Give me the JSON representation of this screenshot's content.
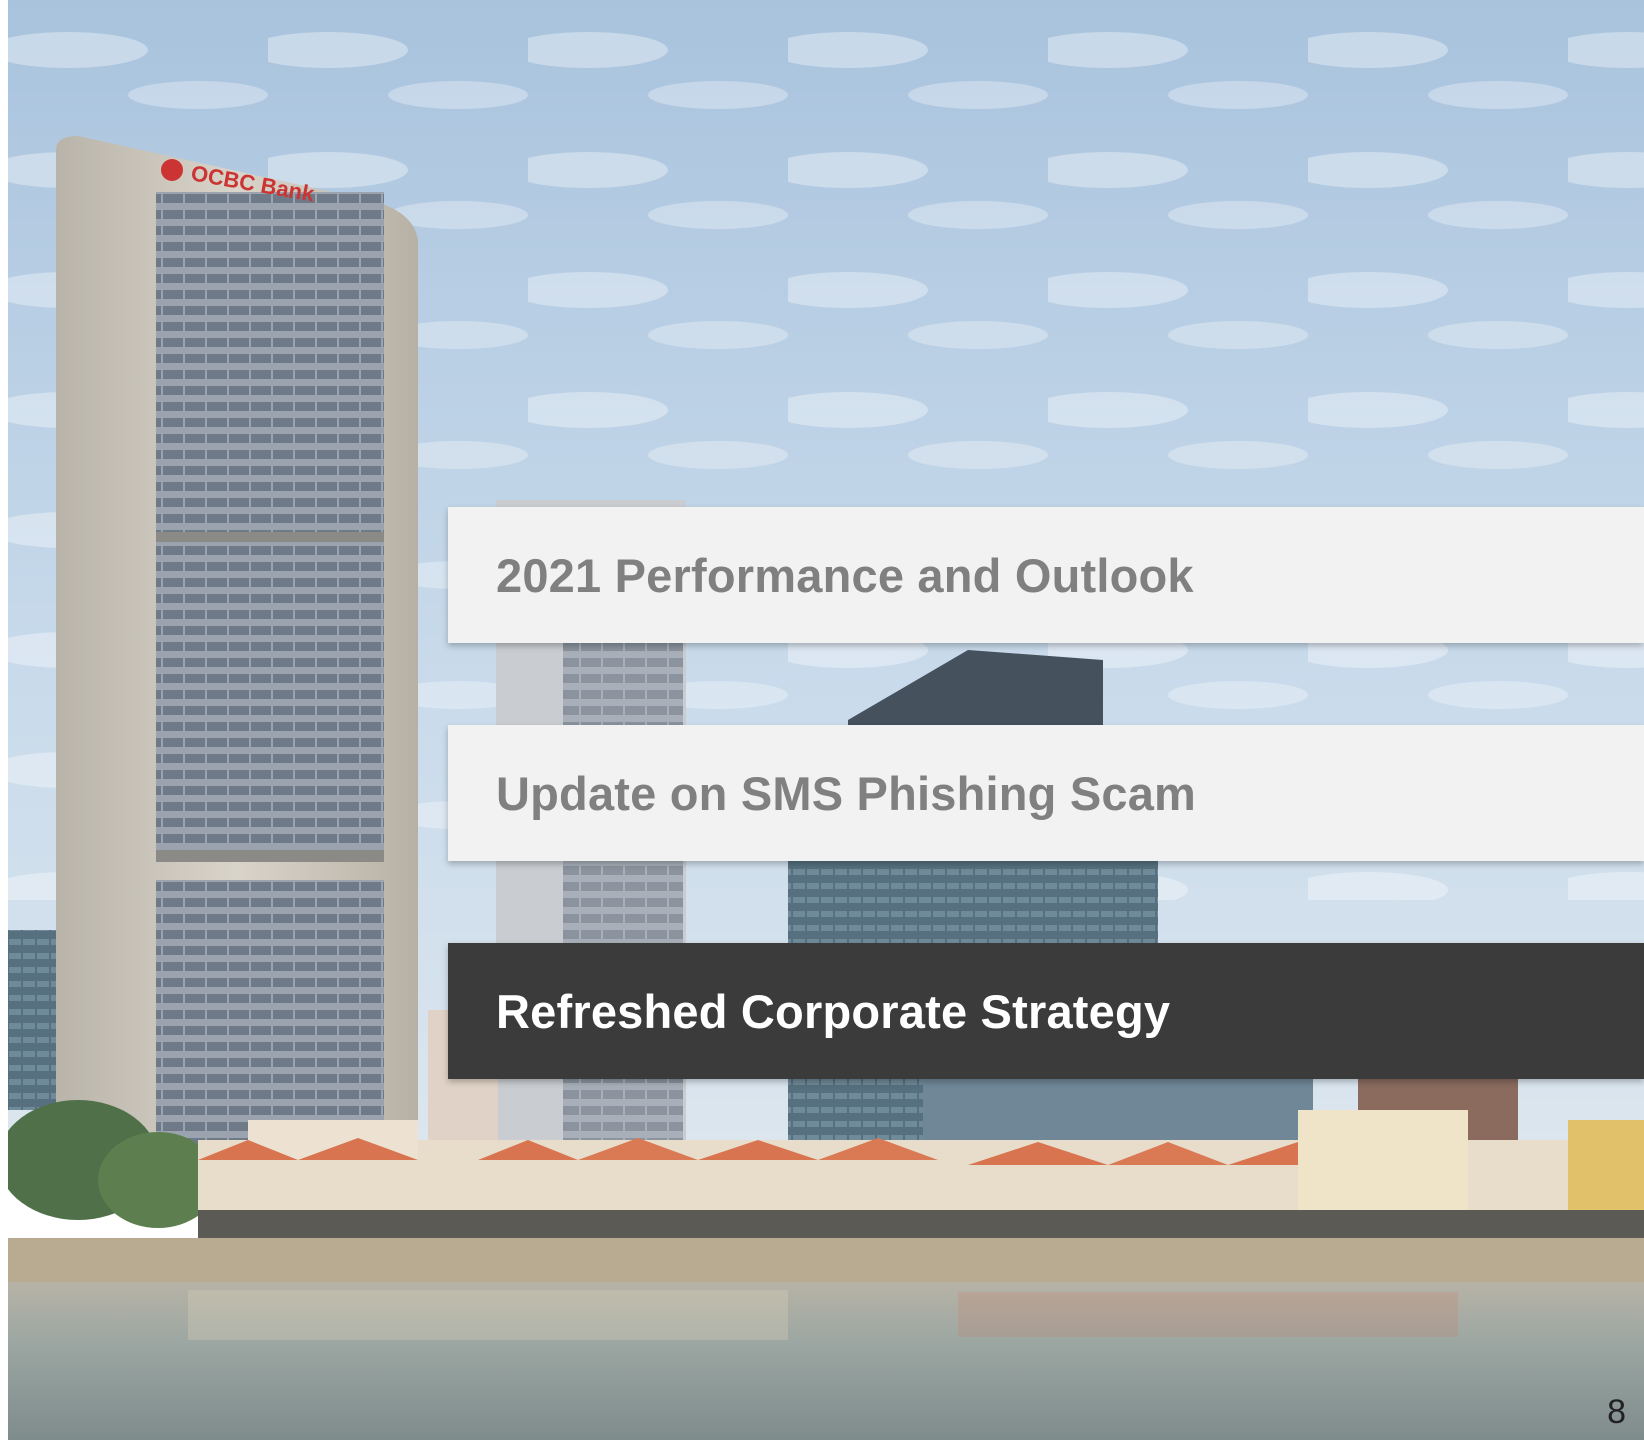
{
  "slide": {
    "background": {
      "signage": "OCBC Bank",
      "sky_color": "#b9cfe3",
      "water_color": "#9ba6a2",
      "roof_color": "#d8744f"
    },
    "agenda_items": [
      {
        "label": "2021 Performance and Outlook",
        "active": false
      },
      {
        "label": "Update on SMS Phishing Scam",
        "active": false
      },
      {
        "label": "Refreshed Corporate Strategy",
        "active": true
      }
    ],
    "page_number": "8",
    "colors": {
      "inactive_bg": "#f2f2f2",
      "inactive_text": "#808080",
      "active_bg": "#3b3b3b",
      "active_text": "#ffffff"
    }
  }
}
